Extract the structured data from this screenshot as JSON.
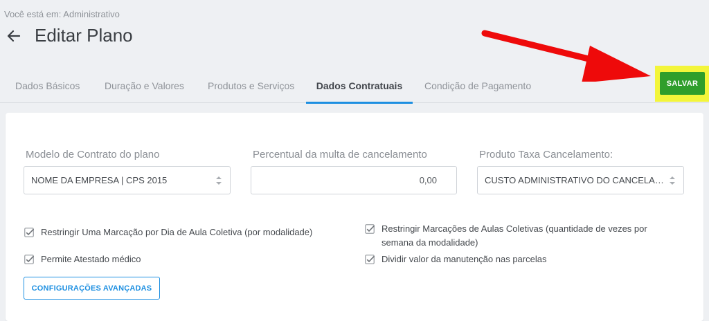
{
  "breadcrumb": "Você está em: Administrativo",
  "page_title": "Editar Plano",
  "tabs": [
    {
      "label": "Dados Básicos"
    },
    {
      "label": "Duração e Valores"
    },
    {
      "label": "Produtos e Serviços"
    },
    {
      "label": "Dados Contratuais",
      "active": true
    },
    {
      "label": "Condição de Pagamento"
    }
  ],
  "save_label": "SALVAR",
  "fields": {
    "contract_model": {
      "label": "Modelo de Contrato do plano",
      "value": "NOME DA EMPRESA | CPS 2015"
    },
    "cancel_fine": {
      "label": "Percentual da multa de cancelamento",
      "value": "0,00"
    },
    "cancel_fee_product": {
      "label": "Produto Taxa Cancelamento:",
      "value": "CUSTO ADMINISTRATIVO DO CANCELAMENTO"
    }
  },
  "checkboxes": [
    {
      "label": "Restringir Uma Marcação por Dia de Aula Coletiva (por modalidade)",
      "checked": true
    },
    {
      "label": "Permite Atestado médico",
      "checked": true
    },
    {
      "label": "Restringir Marcações de Aulas Coletivas (quantidade de vezes por semana da modalidade)",
      "checked": true
    },
    {
      "label": "Dividir valor da manutenção nas parcelas",
      "checked": true
    }
  ],
  "advanced_button": "CONFIGURAÇÕES AVANÇADAS",
  "colors": {
    "accent": "#1d8fe1",
    "save_green": "#2f9e2b",
    "highlight_yellow": "#f3f53a",
    "arrow_red": "#ee0a0a"
  },
  "icons": {
    "back": "arrow-left-icon",
    "select": "updown-chevron-icon",
    "checkbox": "checkbox-checked-icon",
    "annotation": "red-arrow"
  }
}
